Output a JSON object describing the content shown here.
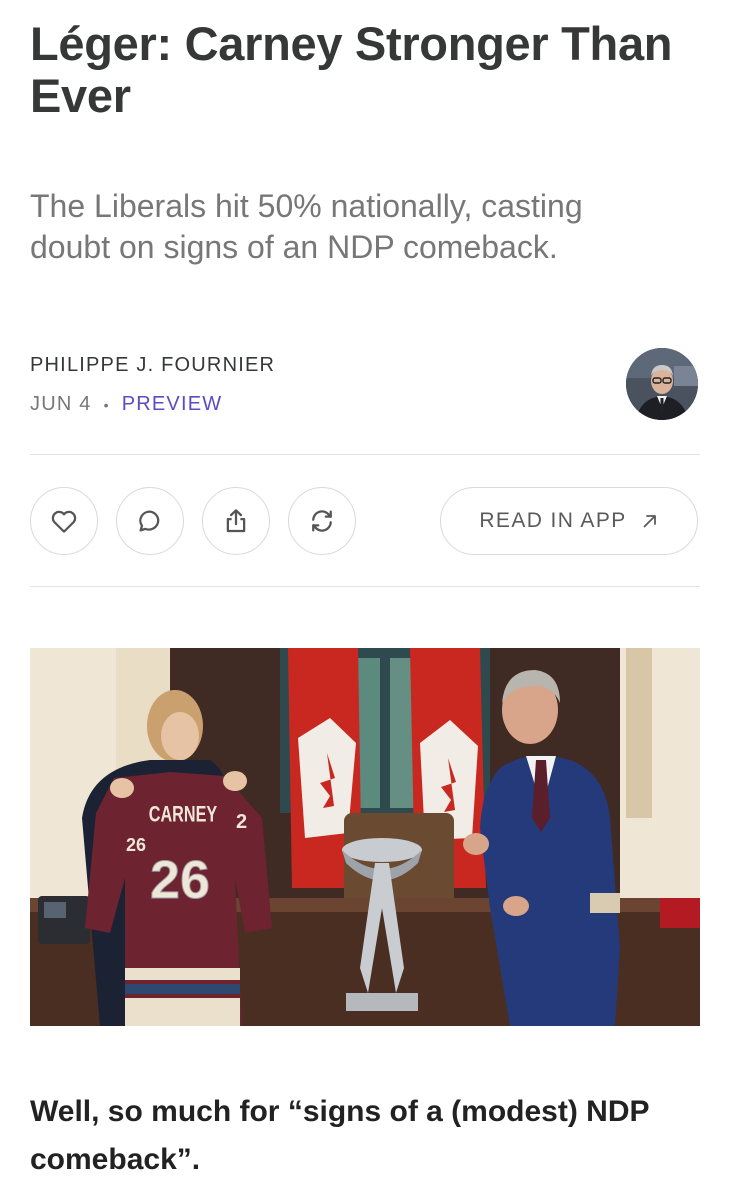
{
  "article": {
    "title": "Léger: Carney Stronger Than Ever",
    "subtitle": "The Liberals hit 50% nationally, casting doubt on signs of an NDP comeback.",
    "author": "PHILIPPE J. FOURNIER",
    "date": "JUN 4",
    "separator": "•",
    "access": "PREVIEW",
    "lede": "Well, so much for “signs of a (modest) NDP comeback”."
  },
  "actions": {
    "icons": [
      "heart-icon",
      "comment-icon",
      "share-icon",
      "restack-icon"
    ],
    "read_in_app_label": "READ IN APP",
    "read_in_app_icon": "arrow-up-right-icon"
  },
  "photo": {
    "jersey_name": "CARNEY",
    "jersey_number": "26",
    "sleeve_number": "26",
    "sleeve_number_right": "2"
  },
  "colors": {
    "title": "#363737",
    "subtitle": "#777777",
    "accent": "#5b4bc4",
    "divider": "#e3e3e3"
  }
}
